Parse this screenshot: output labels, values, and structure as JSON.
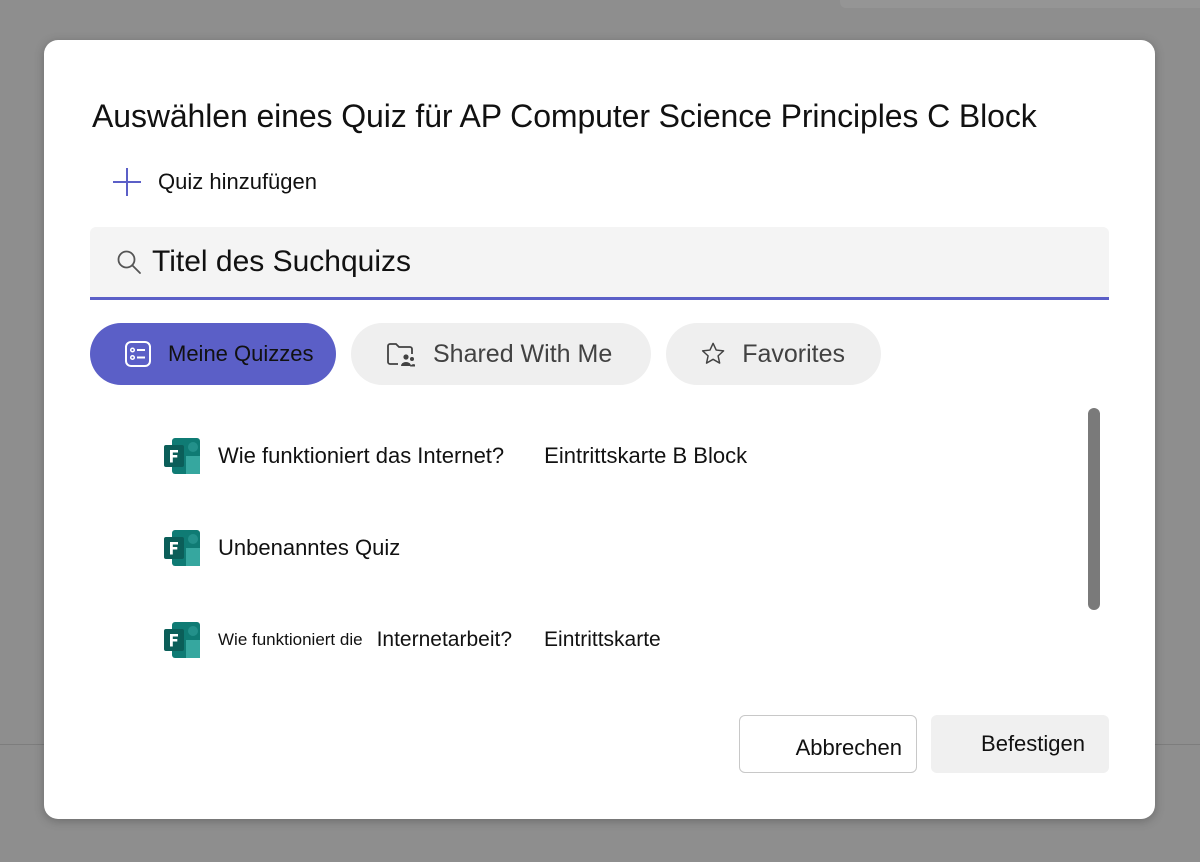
{
  "dialog": {
    "title": "Auswählen eines Quiz für AP Computer Science Principles C Block",
    "add_quiz_label": "Quiz hinzufügen",
    "search": {
      "value": "",
      "placeholder": "Titel des Suchquizs"
    },
    "tabs": [
      {
        "label": "Meine Quizzes",
        "icon": "list-icon",
        "active": true
      },
      {
        "label": "Shared With Me",
        "icon": "shared-folder-icon",
        "active": false
      },
      {
        "label": "Favorites",
        "icon": "star-icon",
        "active": false
      }
    ],
    "quizzes": [
      {
        "name": "Wie funktioniert das Internet?",
        "extra": "Eintrittskarte B Block",
        "icon": "microsoft-forms-icon"
      },
      {
        "name": "Unbenanntes Quiz",
        "extra": "",
        "icon": "microsoft-forms-icon"
      },
      {
        "name": "Wie funktioniert die",
        "mid": "Internetarbeit?",
        "extra": "Eintrittskarte",
        "icon": "microsoft-forms-icon"
      }
    ],
    "buttons": {
      "cancel": "Abbrechen",
      "confirm": "Befestigen"
    }
  },
  "colors": {
    "accent": "#5b5fc7",
    "overlay": "#8e8e8e",
    "tab_inactive_bg": "#efefef",
    "forms_teal": "#0f7b74"
  }
}
